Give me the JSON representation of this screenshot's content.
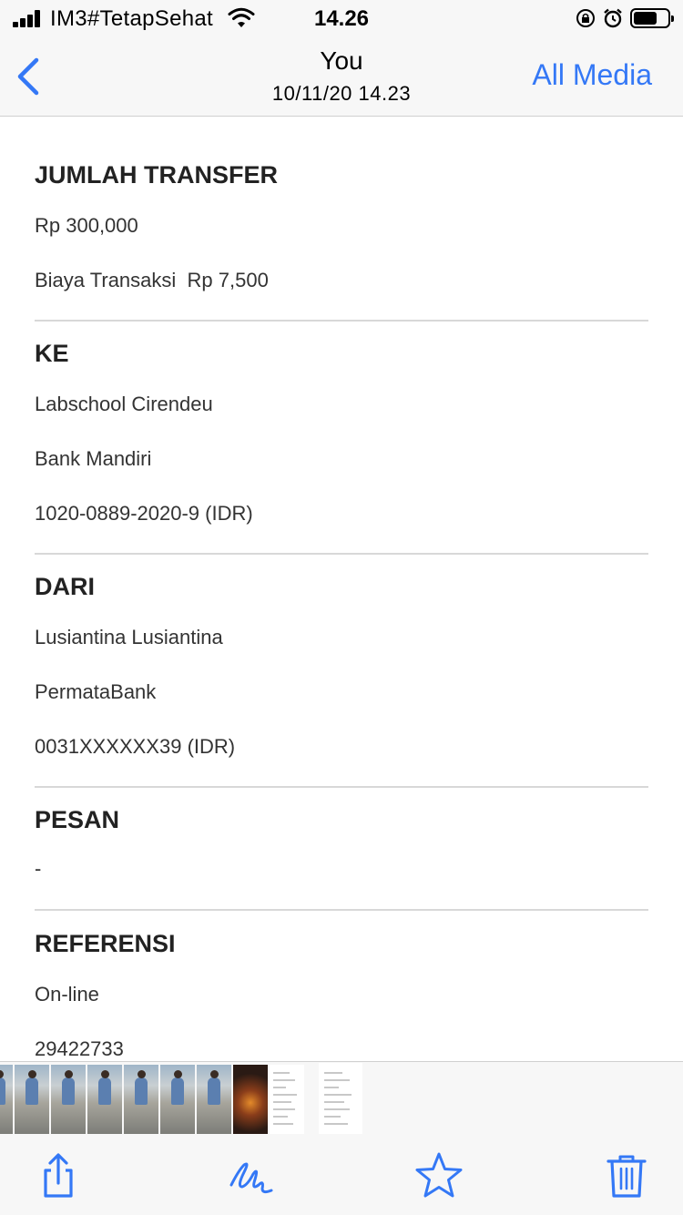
{
  "status_bar": {
    "carrier": "IM3#TetapSehat",
    "time": "14.26",
    "battery_level": 0.7,
    "icons": [
      "signal-icon",
      "wifi-icon",
      "orientation-lock-icon",
      "alarm-icon",
      "battery-icon"
    ]
  },
  "nav": {
    "back_icon": "chevron-left-icon",
    "title": "You",
    "subtitle": "10/11/20 14.23",
    "action_label": "All Media"
  },
  "receipt": {
    "jumlah": {
      "title": "JUMLAH TRANSFER",
      "amount": "Rp 300,000",
      "fee": "Biaya Transaksi  Rp 7,500"
    },
    "ke": {
      "title": "KE",
      "name": "Labschool Cirendeu",
      "bank": "Bank Mandiri",
      "account": "1020-0889-2020-9 (IDR)"
    },
    "dari": {
      "title": "DARI",
      "name": "Lusiantina Lusiantina",
      "bank": "PermataBank",
      "account": "0031XXXXXX39 (IDR)"
    },
    "pesan": {
      "title": "PESAN",
      "value": "-"
    },
    "referensi": {
      "title": "REFERENSI",
      "channel": "On-line",
      "number": "29422733"
    }
  },
  "toolbar": {
    "icons": [
      "share-icon",
      "markup-icon",
      "favorite-star-icon",
      "trash-icon"
    ],
    "accent_color": "#3478f6"
  }
}
